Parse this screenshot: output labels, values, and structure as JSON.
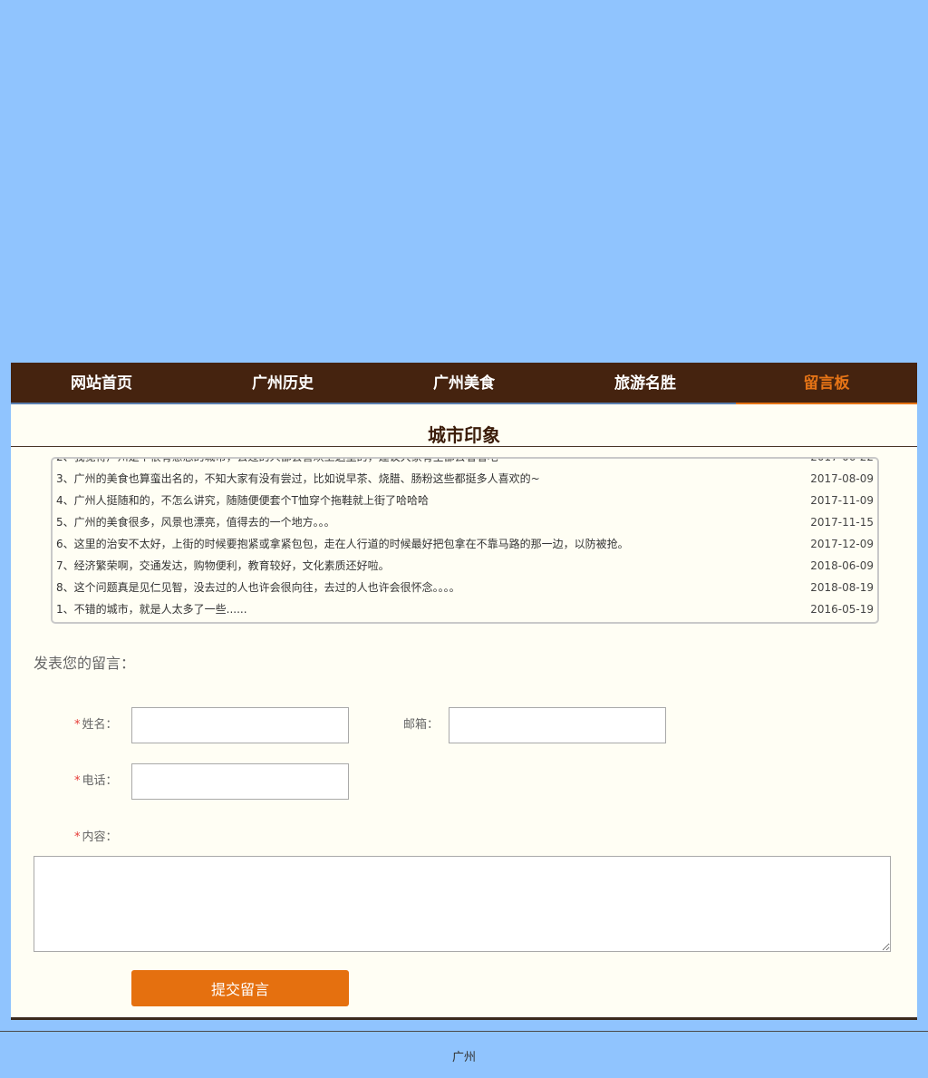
{
  "nav": {
    "items": [
      {
        "label": "网站首页"
      },
      {
        "label": "广州历史"
      },
      {
        "label": "广州美食"
      },
      {
        "label": "旅游名胜"
      },
      {
        "label": "留言板",
        "active": true
      }
    ],
    "background": "#45230f",
    "active_color": "#e67416"
  },
  "section": {
    "title": "城市印象"
  },
  "messages": [
    {
      "text": "3、广州的美食也算蛮出名的，不知大家有没有尝过，比如说早茶、烧腊、肠粉这些都挺多人喜欢的~",
      "date": "2017-08-09"
    },
    {
      "text": "4、广州人挺随和的，不怎么讲究，随随便便套个T恤穿个拖鞋就上街了哈哈哈",
      "date": "2017-11-09"
    },
    {
      "text": "5、广州的美食很多，风景也漂亮，值得去的一个地方。。。",
      "date": "2017-11-15"
    },
    {
      "text": "6、这里的治安不太好，上街的时候要抱紧或拿紧包包，走在人行道的时候最好把包拿在不靠马路的那一边，以防被抢。",
      "date": "2017-12-09"
    },
    {
      "text": "7、经济繁荣啊，交通发达，购物便利，教育较好，文化素质还好啦。",
      "date": "2018-06-09"
    },
    {
      "text": "8、这个问题真是见仁见智，没去过的人也许会很向往，去过的人也许会很怀念。。。。",
      "date": "2018-08-19"
    },
    {
      "text": "1、不错的城市，就是人太多了一些......",
      "date": "2016-05-19"
    }
  ],
  "form": {
    "heading": "发表您的留言：",
    "required_mark": "*",
    "name_label": "姓名：",
    "email_label": "邮箱：",
    "phone_label": "电话：",
    "content_label": "内容：",
    "name_value": "",
    "email_value": "",
    "phone_value": "",
    "content_value": "",
    "submit_label": "提交留言",
    "submit_color": "#e5700f"
  },
  "footer": {
    "text": "广州"
  },
  "colors": {
    "page_background": "#90c4fe",
    "panel_background": "#fffef4"
  }
}
